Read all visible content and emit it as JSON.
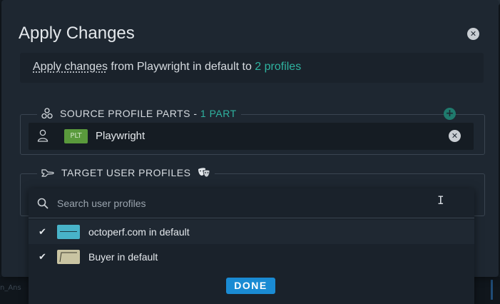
{
  "dialog": {
    "title": "Apply Changes",
    "close_icon": "close-icon"
  },
  "summary": {
    "prefix": "Apply changes",
    "middle": " from Playwright in default to ",
    "link": "2 profiles"
  },
  "source_section": {
    "label": "SOURCE PROFILE PARTS - ",
    "count": "1 PART",
    "icon": "parts-icon",
    "add_icon": "plus-icon",
    "parts": [
      {
        "badge": "PLT",
        "name": "Playwright",
        "badge_color": "#5a9a3c"
      }
    ]
  },
  "target_section": {
    "label": "TARGET USER PROFILES",
    "icon": "airplane-icon",
    "extra_icon": "masks-icon"
  },
  "dropdown": {
    "search_placeholder": "Search user profiles",
    "options": [
      {
        "label": "octoperf.com in default",
        "checked": true,
        "thumb_color": "#48b3c9"
      },
      {
        "label": "Buyer in default",
        "checked": true,
        "thumb_color": "#c9c4a2"
      }
    ],
    "done_label": "DONE"
  },
  "background": {
    "partial_text": "n_Ans"
  },
  "colors": {
    "accent_teal": "#2fb3a0",
    "primary_blue": "#1a8bd3"
  }
}
